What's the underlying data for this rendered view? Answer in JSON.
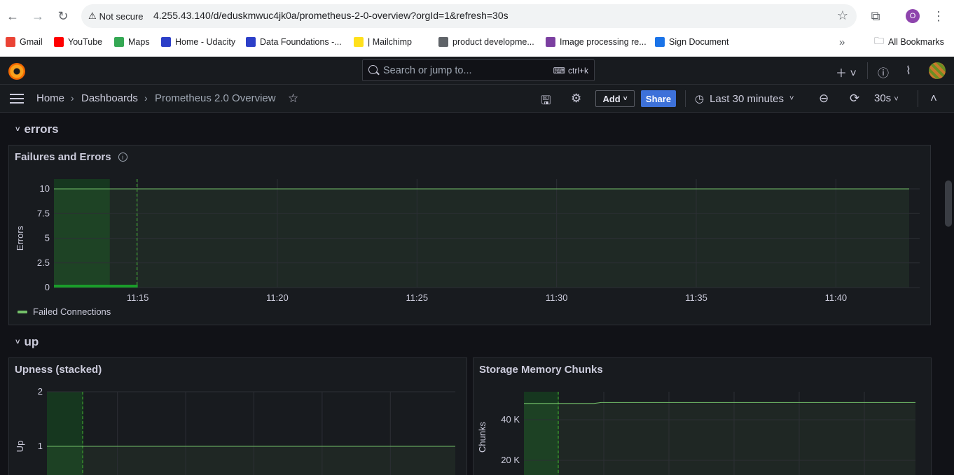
{
  "browser": {
    "security_label": "Not secure",
    "url": "4.255.43.140/d/eduskmwuc4jk0a/prometheus-2-0-overview?orgId=1&refresh=30s",
    "profile_initial": "O",
    "bookmarks": [
      {
        "label": "Gmail",
        "icon": "gmail-icon",
        "color": "#ea4335"
      },
      {
        "label": "YouTube",
        "icon": "youtube-icon",
        "color": "#ff0000"
      },
      {
        "label": "Maps",
        "icon": "maps-icon",
        "color": "#34a853"
      },
      {
        "label": "Home - Udacity",
        "icon": "udacity-icon",
        "color": "#2c3fc8"
      },
      {
        "label": "Data Foundations -...",
        "icon": "udacity-icon",
        "color": "#2c3fc8"
      },
      {
        "label": "| Mailchimp",
        "icon": "mailchimp-icon",
        "color": "#ffe01b"
      },
      {
        "label": "product developme...",
        "icon": "globe-icon",
        "color": "#5f6368"
      },
      {
        "label": "Image processing re...",
        "icon": "jpg-icon",
        "color": "#7b3fa0"
      },
      {
        "label": "Sign Document",
        "icon": "sign-icon",
        "color": "#1a73e8"
      }
    ],
    "overflow_label": "»",
    "all_bookmarks": "All Bookmarks"
  },
  "grafana": {
    "search_placeholder": "Search or jump to...",
    "search_shortcut": "ctrl+k",
    "breadcrumbs": [
      "Home",
      "Dashboards",
      "Prometheus 2.0 Overview"
    ],
    "add_label": "Add",
    "share_label": "Share",
    "time_range": "Last 30 minutes",
    "refresh_interval": "30s"
  },
  "rows": [
    {
      "title": "errors"
    },
    {
      "title": "up"
    }
  ],
  "panels": {
    "failures": {
      "title": "Failures and Errors",
      "legend": "Failed Connections"
    },
    "upness": {
      "title": "Upness (stacked)"
    },
    "storage": {
      "title": "Storage Memory Chunks"
    }
  },
  "chart_data": [
    {
      "type": "line",
      "title": "Failures and Errors",
      "ylabel": "Errors",
      "ylim": [
        0,
        10
      ],
      "y_ticks": [
        "0",
        "2.5",
        "5",
        "7.5",
        "10"
      ],
      "x_ticks": [
        "11:15",
        "11:20",
        "11:25",
        "11:30",
        "11:35",
        "11:40"
      ],
      "series": [
        {
          "name": "Failed Connections",
          "x": [
            "11:12",
            "11:15",
            "11:42"
          ],
          "values": [
            0,
            0,
            0
          ]
        }
      ],
      "threshold": {
        "value": 10,
        "color": "#73bf69"
      },
      "grid": true,
      "legend": "bottom-left"
    },
    {
      "type": "line",
      "title": "Upness (stacked)",
      "ylabel": "Up",
      "y_ticks": [
        "1",
        "2"
      ],
      "series": [
        {
          "x": [
            "11:12",
            "11:42"
          ],
          "values": [
            1,
            1
          ]
        }
      ],
      "grid": true
    },
    {
      "type": "line",
      "title": "Storage Memory Chunks",
      "ylabel": "Chunks",
      "y_ticks": [
        "20 K",
        "40 K"
      ],
      "series": [
        {
          "x": [
            "11:12",
            "11:42"
          ],
          "values": [
            48000,
            48500
          ]
        }
      ],
      "grid": true
    }
  ],
  "colors": {
    "accent": "#3d71d9",
    "series_green": "#73bf69",
    "bg": "#111217",
    "panel": "#181b1f"
  }
}
